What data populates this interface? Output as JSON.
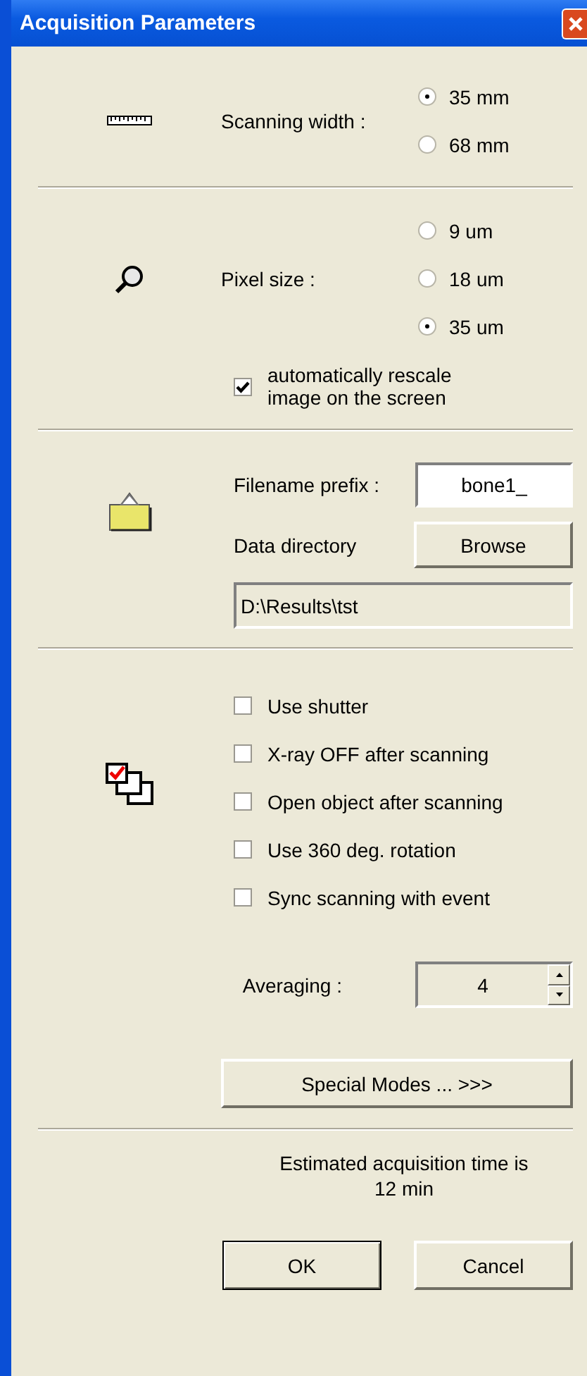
{
  "window": {
    "title": "Acquisition Parameters"
  },
  "scanning_width": {
    "label": "Scanning width :",
    "options": [
      {
        "label": "35 mm",
        "selected": true
      },
      {
        "label": "68 mm",
        "selected": false
      }
    ]
  },
  "pixel_size": {
    "label": "Pixel size :",
    "options": [
      {
        "label": "9 um",
        "selected": false
      },
      {
        "label": "18 um",
        "selected": false
      },
      {
        "label": "35 um",
        "selected": true
      }
    ],
    "rescale": {
      "label": "automatically rescale image on the screen",
      "checked": true
    }
  },
  "files": {
    "prefix_label": "Filename prefix :",
    "prefix_value": "bone1_",
    "directory_label": "Data directory",
    "browse_button": "Browse",
    "directory_value": "D:\\Results\\tst"
  },
  "options": [
    {
      "label": "Use shutter",
      "checked": false
    },
    {
      "label": "X-ray OFF after scanning",
      "checked": false
    },
    {
      "label": "Open object after scanning",
      "checked": false
    },
    {
      "label": "Use 360 deg. rotation",
      "checked": false
    },
    {
      "label": "Sync scanning with event",
      "checked": false
    }
  ],
  "averaging": {
    "label": "Averaging :",
    "value": "4"
  },
  "special_modes_button": "Special Modes ...  >>>",
  "estimate": {
    "line_1": "Estimated acquisition time is",
    "line_2": "12 min"
  },
  "buttons": [
    {
      "label": "OK",
      "default": true
    },
    {
      "label": "Cancel",
      "default": false
    }
  ]
}
